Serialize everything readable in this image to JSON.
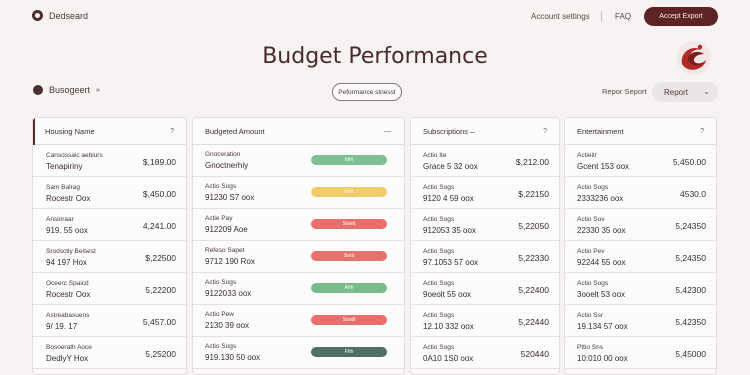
{
  "header": {
    "logo_text": "Dedseard",
    "nav": {
      "account": "Account settings",
      "faq": "FAQ"
    },
    "export_label": "Accept Export"
  },
  "page_title": "Budget Performance",
  "subbar": {
    "budget_label": "Busogeert",
    "budget_arrow": "»",
    "performance_button": "Peformance stnesst",
    "report_label": "Repor Seport",
    "report_select": "Report",
    "report_chevron": "⌄"
  },
  "columns": [
    {
      "header": "Housing Name",
      "info": "?",
      "rows": [
        {
          "l1": "Cansossaic aebiurs",
          "l2": "Tenapiriny",
          "val": "$,189.00"
        },
        {
          "l1": "Sam Balrag",
          "l2": "Rocestr Oox",
          "val": "$,450.00"
        },
        {
          "l1": "Ansioraar",
          "l2": "919. 55 oox",
          "val": "4,241.00"
        },
        {
          "l1": "Srodsctiy Belsest",
          "l2": "94 197 Hox",
          "val": "$,22500"
        },
        {
          "l1": "Oceerc Spaicd",
          "l2": "Rocestr Oox",
          "val": "5,22200"
        },
        {
          "l1": "Astreabasuens",
          "l2": "9/ 19. 17",
          "val": "5,457.00"
        },
        {
          "l1": "Bosoerath Aoce",
          "l2": "DedlyY Hox",
          "val": "5,25200"
        }
      ]
    },
    {
      "header": "Budgeted Amount",
      "info": "—",
      "rows": [
        {
          "l1": "Gnoceration",
          "l2": "Gnoctnerhiy",
          "pill": "hhh",
          "color": "#7fbf95"
        },
        {
          "l1": "Actio Sogs",
          "l2": "91230 S7 oox",
          "pill": "tont",
          "color": "#f0cd6a"
        },
        {
          "l1": "Actie Pay",
          "l2": "912209 Aoe",
          "pill": "Soont",
          "color": "#e8706c"
        },
        {
          "l1": "Refeso Sapet",
          "l2": "9712 190 Rox",
          "pill": "Sont",
          "color": "#e8736c"
        },
        {
          "l1": "Actio Sogs",
          "l2": "9122033 oox",
          "pill": "Ahh",
          "color": "#79bb8a"
        },
        {
          "l1": "Actio Pew",
          "l2": "2130 39 oox",
          "pill": "Sootit",
          "color": "#e8706c"
        },
        {
          "l1": "Actio Sogs",
          "l2": "919.130 50 oox",
          "pill": "Fhh",
          "color": "#4e6f62"
        }
      ]
    },
    {
      "header": "Subscriptions –",
      "info": "?",
      "rows": [
        {
          "l1": "Actio Ite",
          "l2": "Grace 5 32 oox",
          "val": "$,212.00"
        },
        {
          "l1": "Actio Sogs",
          "l2": "9120 4 59 oox",
          "val": "$,22150"
        },
        {
          "l1": "Actio Sogs",
          "l2": "912053 35 oox",
          "val": "5,22050"
        },
        {
          "l1": "Actio Sogs",
          "l2": "97.1053 57 oox",
          "val": "5,22330"
        },
        {
          "l1": "Actio Sogs",
          "l2": "9oeolt 55 oox",
          "val": "5,22400"
        },
        {
          "l1": "Actio Sogs",
          "l2": "12.10 332 oox",
          "val": "5,22440"
        },
        {
          "l1": "Actio Sogs",
          "l2": "0A10 1S0 oox",
          "val": "520440"
        }
      ]
    },
    {
      "header": "Entertainment",
      "info": "?",
      "rows": [
        {
          "l1": "Actieitr",
          "l2": "Gcent 153 oox",
          "val": "5,450.00"
        },
        {
          "l1": "Actio Sogs",
          "l2": "2333236 oox",
          "val": "4530.0"
        },
        {
          "l1": "Actio Sov",
          "l2": "22330 35 oox",
          "val": "5,24350"
        },
        {
          "l1": "Actio Pev",
          "l2": "92244 55 oox",
          "val": "5,24350"
        },
        {
          "l1": "Actio Sogs",
          "l2": "3ooelt 53 oox",
          "val": "5,42300"
        },
        {
          "l1": "Actio Ssr",
          "l2": "19.134 57 oox",
          "val": "5,42350"
        },
        {
          "l1": "Pttio Sns",
          "l2": "10:010 00 oox",
          "val": "5,45000"
        }
      ]
    }
  ]
}
